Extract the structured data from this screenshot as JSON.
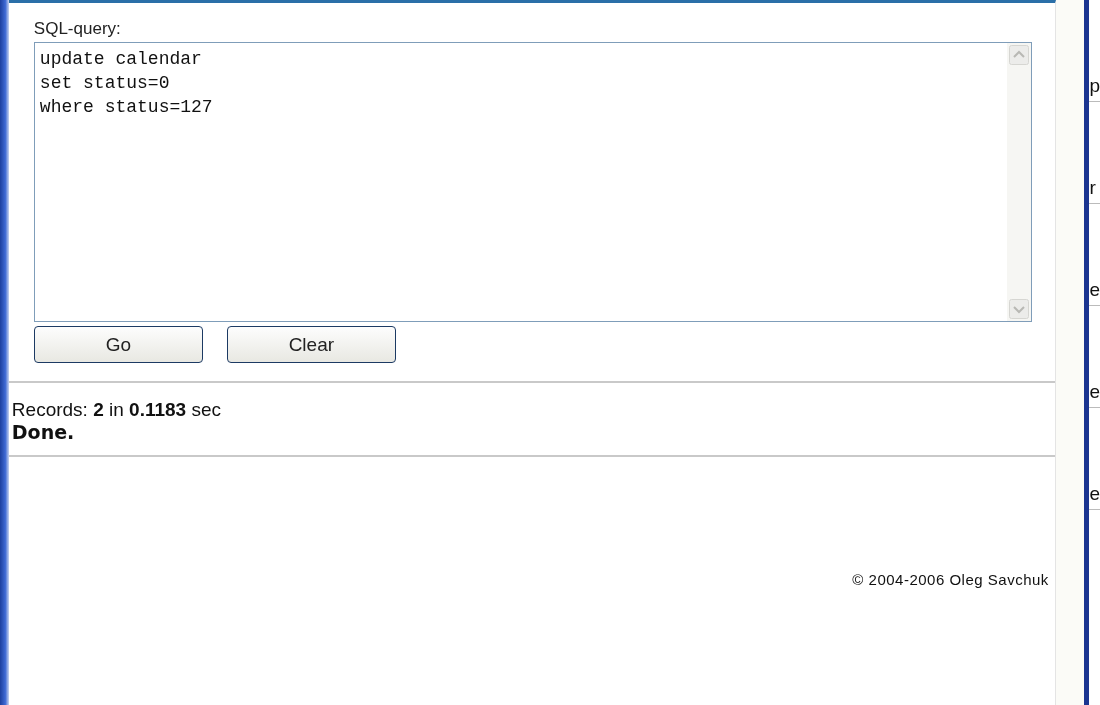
{
  "query_form": {
    "label": "SQL-query:",
    "value": "update calendar\nset status=0\nwhere status=127",
    "buttons": [
      "Go",
      "Clear"
    ]
  },
  "result": {
    "summary": "Records: **2** in **0.1183** sec",
    "status": "Done."
  },
  "footer": {
    "copyright": "© 2004-2006 Oleg Savchuk"
  },
  "side_panel": {
    "fragments": [
      "p",
      "r",
      "e",
      "e",
      "e"
    ]
  }
}
